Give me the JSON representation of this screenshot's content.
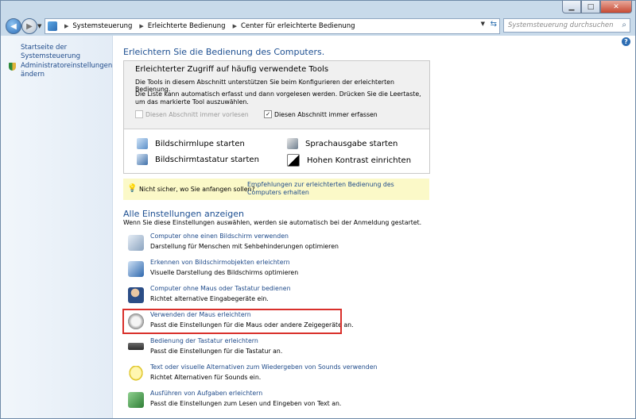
{
  "address": {
    "crumbs": [
      "Systemsteuerung",
      "Erleichterte Bedienung",
      "Center für erleichterte Bedienung"
    ]
  },
  "search": {
    "placeholder": "Systemsteuerung durchsuchen"
  },
  "sidebar": {
    "home_link": "Startseite der Systemsteuerung",
    "admin_link_1": "Administratoreinstellungen",
    "admin_link_2": "ändern"
  },
  "main": {
    "title": "Erleichtern Sie die Bedienung des Computers.",
    "quick": {
      "title": "Erleichterter Zugriff auf häufig verwendete Tools",
      "desc1": "Die Tools in diesem Abschnitt unterstützen Sie beim Konfigurieren der erleichterten Bedienung.",
      "desc2": "Die Liste kann automatisch erfasst und dann vorgelesen werden. Drücken Sie die Leertaste, um das markierte Tool auszuwählen.",
      "check_read": "Diesen Abschnitt immer vorlesen",
      "check_scan": "Diesen Abschnitt immer erfassen",
      "check_scan_checked": true,
      "tools": [
        {
          "label": "Bildschirmlupe starten",
          "icon": "magnifier-icon"
        },
        {
          "label": "Sprachausgabe starten",
          "icon": "narrator-icon"
        },
        {
          "label": "Bildschirmtastatur starten",
          "icon": "onscreen-keyboard-icon"
        },
        {
          "label": "Hohen Kontrast einrichten",
          "icon": "high-contrast-icon"
        }
      ]
    },
    "tip": {
      "question": "Nicht sicher, wo Sie anfangen sollen?",
      "link": "Empfehlungen zur erleichterten Bedienung des Computers erhalten"
    },
    "all": {
      "title": "Alle Einstellungen anzeigen",
      "desc": "Wenn Sie diese Einstellungen auswählen, werden sie automatisch bei der Anmeldung gestartet.",
      "items": [
        {
          "link": "Computer ohne einen Bildschirm verwenden",
          "desc": "Darstellung für Menschen mit Sehbehinderungen optimieren"
        },
        {
          "link": "Erkennen von Bildschirmobjekten erleichtern",
          "desc": "Visuelle Darstellung des Bildschirms optimieren"
        },
        {
          "link": "Computer ohne Maus oder Tastatur bedienen",
          "desc": "Richtet alternative Eingabegeräte ein."
        },
        {
          "link": "Verwenden der Maus erleichtern",
          "desc": "Passt die Einstellungen für die Maus oder andere Zeigegeräte an."
        },
        {
          "link": "Bedienung der Tastatur erleichtern",
          "desc": "Passt die Einstellungen für die Tastatur an."
        },
        {
          "link": "Text oder visuelle Alternativen zum Wiedergeben von Sounds verwenden",
          "desc": "Richtet Alternativen für Sounds ein."
        },
        {
          "link": "Ausführen von Aufgaben erleichtern",
          "desc": "Passt die Einstellungen zum Lesen und Eingeben von Text an."
        }
      ]
    }
  }
}
